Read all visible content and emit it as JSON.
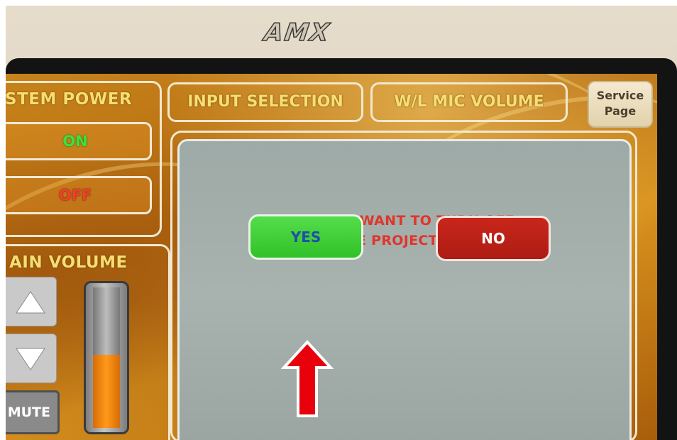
{
  "device": {
    "brand": "AMX"
  },
  "left_panel": {
    "power_title": "STEM POWER",
    "power_on_label": "ON",
    "power_off_label": "OFF",
    "volume_title": "AIN VOLUME",
    "volume_up_icon": "up-triangle-icon",
    "volume_down_icon": "down-triangle-icon",
    "mute_label": "MUTE",
    "volume_level_percent": 52
  },
  "tabs": [
    {
      "label": "INPUT SELECTION"
    },
    {
      "label": "W/L MIC VOLUME"
    }
  ],
  "service_page": {
    "line1": "Service",
    "line2": "Page"
  },
  "dialog": {
    "question_line1": "DO YOU WANT TO TURN OFF",
    "question_line2": "THE PROJECTOR ?",
    "yes_label": "YES",
    "no_label": "NO"
  },
  "annotation": {
    "arrow_icon": "red-up-arrow-icon",
    "arrow_color": "#e8000b"
  },
  "colors": {
    "on_green": "#39e23c",
    "off_red": "#f0402a",
    "title_yellow": "#f6df72",
    "question_red": "#e0352a",
    "yes_green": "#43d03a",
    "no_red": "#bd2218",
    "yes_text_blue": "#1f4fa8",
    "dialog_gray": "#a3aeaa"
  }
}
